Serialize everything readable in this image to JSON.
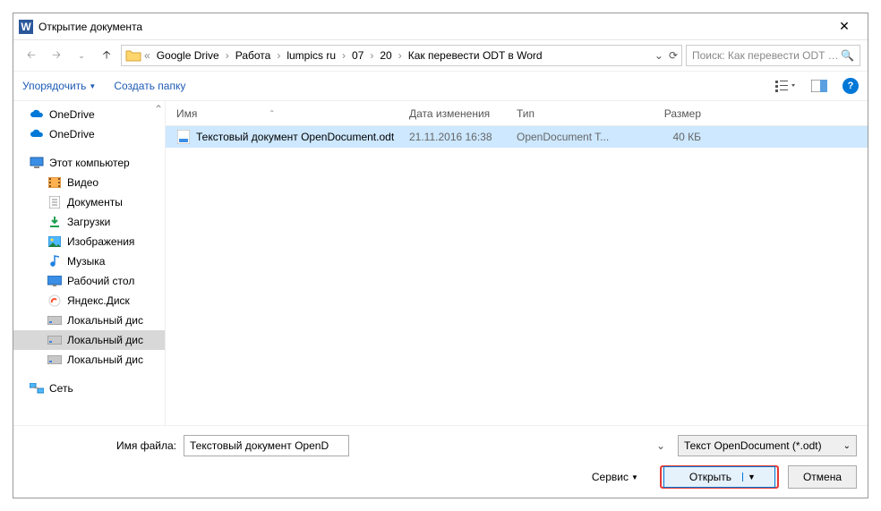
{
  "window": {
    "title": "Открытие документа"
  },
  "breadcrumbs": [
    "Google Drive",
    "Работа",
    "lumpics ru",
    "07",
    "20",
    "Как перевести ODT в Word"
  ],
  "search": {
    "placeholder": "Поиск: Как перевести ODT в ..."
  },
  "toolbar": {
    "organize": "Упорядочить",
    "newfolder": "Создать папку"
  },
  "tree": {
    "onedrive1": "OneDrive",
    "onedrive2": "OneDrive",
    "thispc": "Этот компьютер",
    "videos": "Видео",
    "documents": "Документы",
    "downloads": "Загрузки",
    "pictures": "Изображения",
    "music": "Музыка",
    "desktop": "Рабочий стол",
    "yandex": "Яндекс.Диск",
    "disk1": "Локальный дис",
    "disk2": "Локальный дис",
    "disk3": "Локальный дис",
    "network": "Сеть"
  },
  "columns": {
    "name": "Имя",
    "date": "Дата изменения",
    "type": "Тип",
    "size": "Размер"
  },
  "file": {
    "name": "Текстовый документ OpenDocument.odt",
    "date": "21.11.2016 16:38",
    "type": "OpenDocument T...",
    "size": "40 КБ"
  },
  "footer": {
    "filename_label": "Имя файла:",
    "filename_value": "Текстовый документ OpenDocument.odt",
    "filetype": "Текст OpenDocument (*.odt)",
    "service": "Сервис",
    "open": "Открыть",
    "cancel": "Отмена"
  }
}
